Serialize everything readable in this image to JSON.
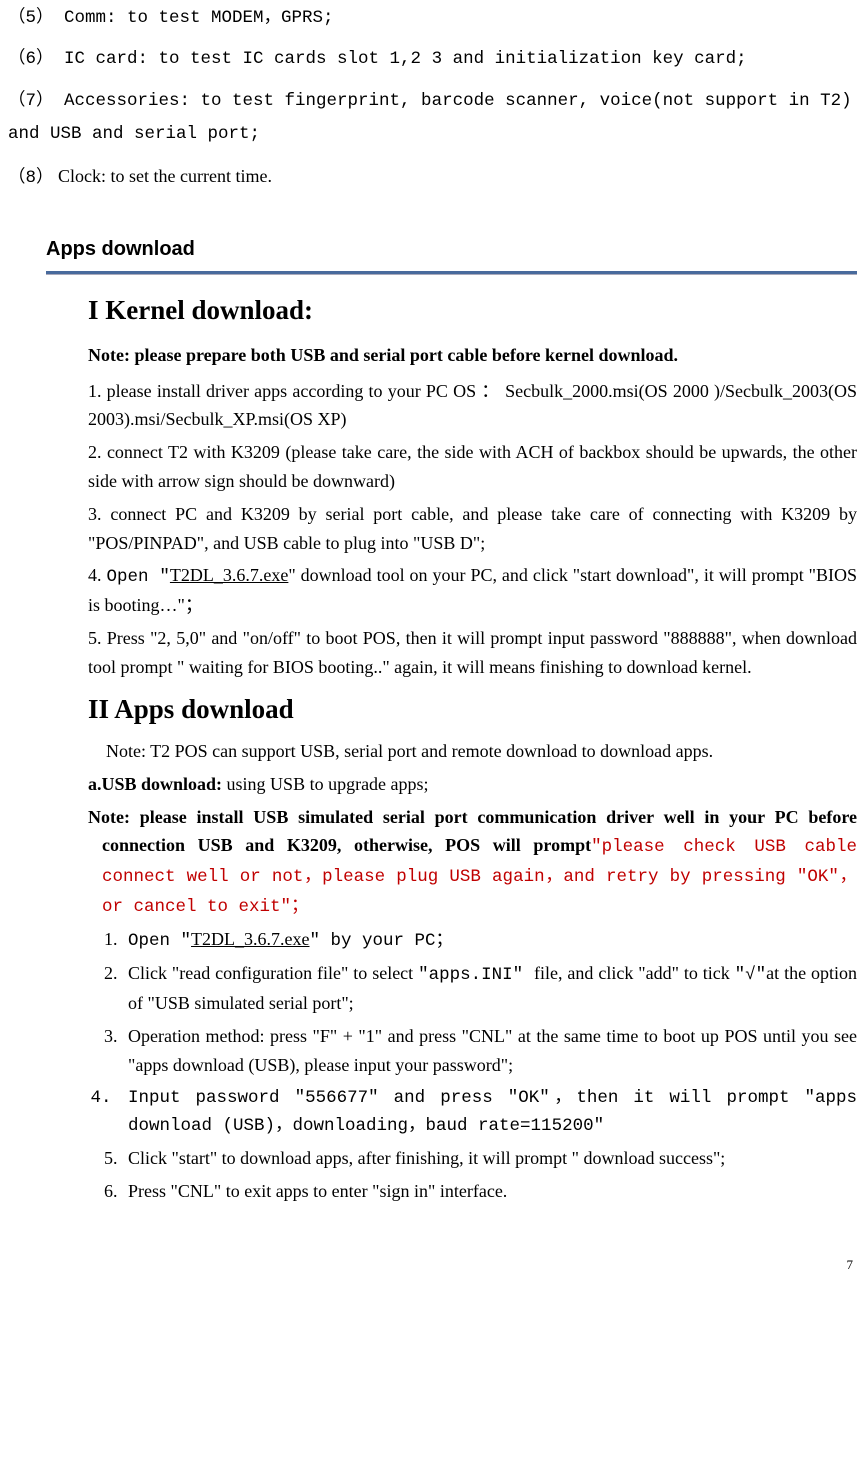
{
  "top": {
    "l5": "（5） Comm: to test MODEM，GPRS;",
    "l6": "（6） IC card: to test IC cards slot 1,2 3 and initialization key card;",
    "l7": "（7） Accessories: to test fingerprint, barcode scanner, voice(not support in T2) and USB and serial port;",
    "l8a": "（8）",
    "l8b": "  Clock: to set the current time."
  },
  "section_header": "Apps download",
  "h1": "I Kernel download:",
  "note1": "Note: please prepare both USB and serial port cable before kernel download.",
  "p1": "1. please install driver apps according to your PC OS ： Secbulk_2000.msi(OS 2000 )/Secbulk_2003(OS 2003).msi/Secbulk_XP.msi(OS XP)",
  "p2": "2. connect T2 with K3209 (please take care, the side with ACH of backbox should be upwards, the other side with arrow sign should be downward)",
  "p3": "3. connect PC and K3209 by serial port cable, and please take care of connecting with K3209 by \"POS/PINPAD\", and USB cable to plug into \"USB D\";",
  "p4a": "4. ",
  "p4b": "Open \"",
  "p4c": "T2DL_3.6.7.exe",
  "p4d": "\" download tool on your PC, and click \"start download\", it will prompt \"BIOS is booting…\"；",
  "p5": "5. Press \"2, 5,0\"  and \"on/off\" to boot POS, then it will prompt input password \"888888\", when download tool prompt \" waiting for BIOS booting..\" again, it will means finishing to download kernel.",
  "h2": "II Apps download",
  "note2_indent": "    Note: T2 POS can support USB, serial port and remote download to download apps.",
  "usb_a": "a.USB download:",
  "usb_b": " using USB to upgrade apps;",
  "note3a": "Note: please install USB simulated serial port communication driver well in your PC before connection USB and K3209, otherwise, POS will prompt",
  "note3b": "\"please check USB cable connect well or not，please plug USB again，and retry by pressing \"OK\"，or cancel to exit\"；",
  "li1a": "Open \"",
  "li1b": "T2DL_3.6.7.exe",
  "li1c": "\" by your PC；",
  "li2a": "Click \"read configuration file\" to select",
  "li2b": "\"apps.INI\" ",
  "li2c": " file, and click \"add\" to tick ",
  "li2d": "\"√\"",
  "li2e": "at the option of \"USB simulated serial port\";",
  "li3": "Operation method: press \"F\" + \"1\" and press \"CNL\" at the same time to boot up POS until you see \"apps download (USB), please input your password\";",
  "li4": "Input password \"556677\" and press \"OK\"，then it will prompt \"apps download (USB)，downloading，baud rate=115200\"",
  "li5": "Click \"start\" to download apps, after finishing, it will prompt \" download success\";",
  "li6": "Press \"CNL\" to exit apps to enter \"sign in\" interface.",
  "page": "7"
}
